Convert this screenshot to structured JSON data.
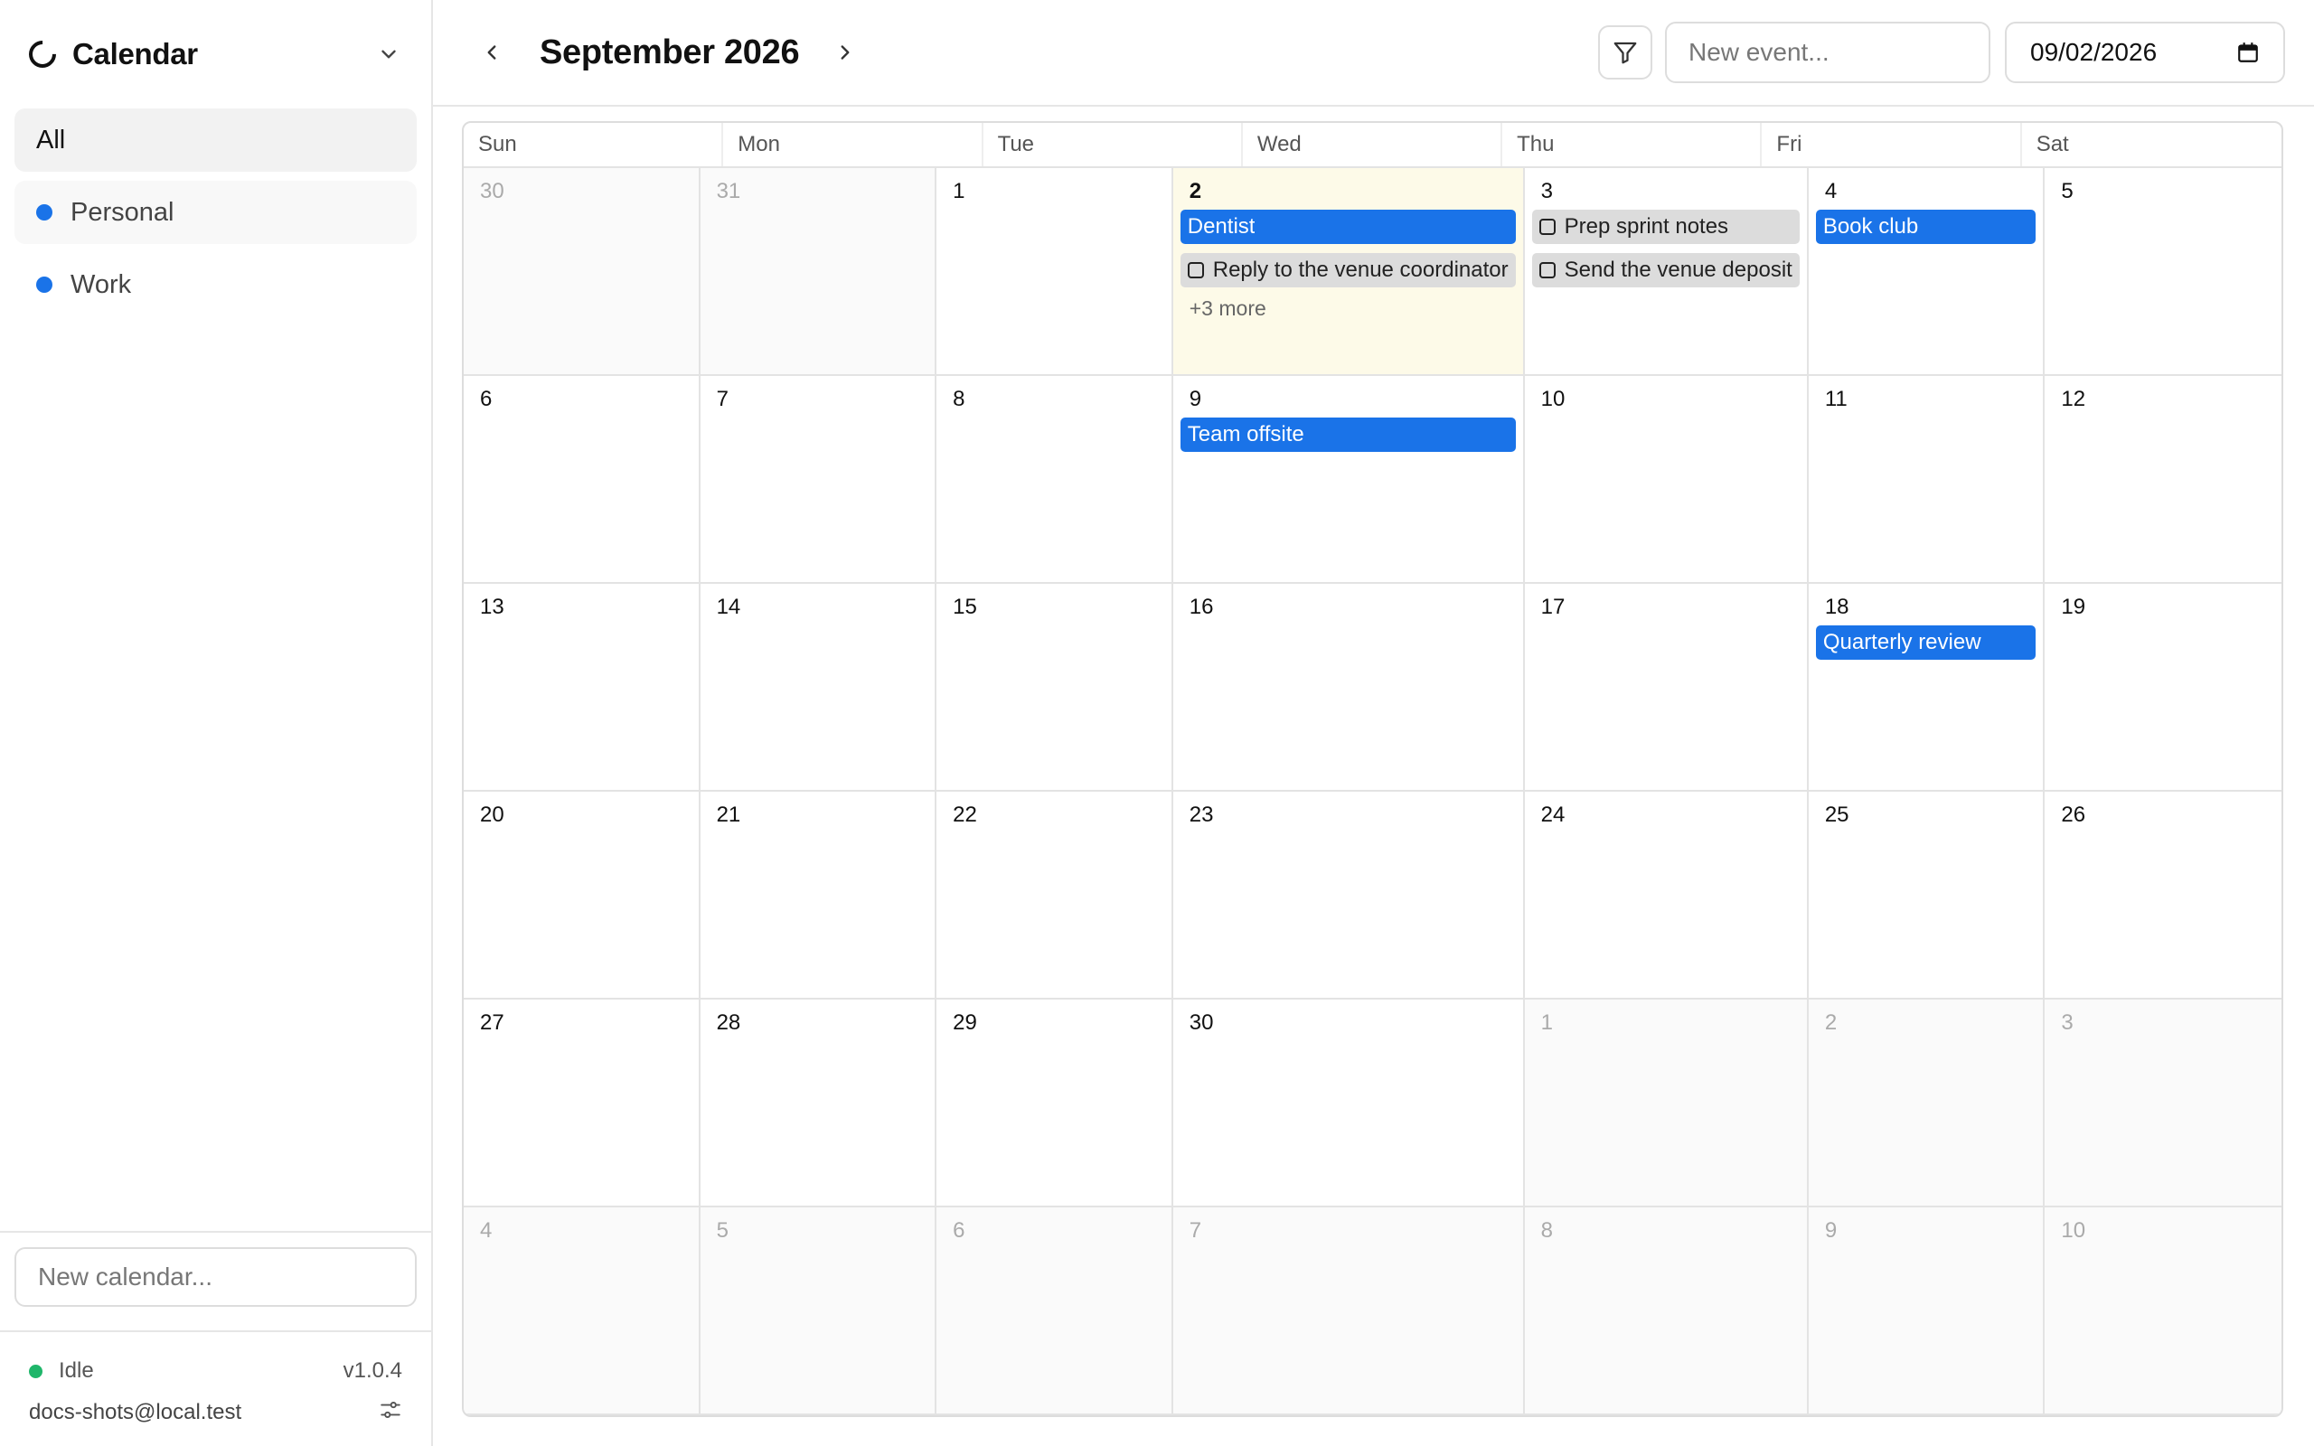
{
  "sidebar": {
    "title": "Calendar",
    "items": [
      {
        "label": "All"
      },
      {
        "label": "Personal",
        "color": "#1a73e8"
      },
      {
        "label": "Work",
        "color": "#1a73e8"
      }
    ],
    "new_calendar_placeholder": "New calendar...",
    "status": "Idle",
    "version": "v1.0.4",
    "email": "docs-shots@local.test"
  },
  "header": {
    "month": "September 2026",
    "new_event_placeholder": "New event...",
    "date_value": "09/02/2026"
  },
  "calendar": {
    "weekdays": [
      "Sun",
      "Mon",
      "Tue",
      "Wed",
      "Thu",
      "Fri",
      "Sat"
    ],
    "cells": [
      {
        "day": "30",
        "out": true
      },
      {
        "day": "31",
        "out": true
      },
      {
        "day": "1"
      },
      {
        "day": "2",
        "today": true,
        "events": [
          {
            "title": "Dentist",
            "type": "event"
          },
          {
            "title": "Reply to the venue coordinator",
            "type": "task"
          }
        ],
        "more": "+3 more"
      },
      {
        "day": "3",
        "events": [
          {
            "title": "Prep sprint notes",
            "type": "task"
          },
          {
            "title": "Send the venue deposit",
            "type": "task"
          }
        ]
      },
      {
        "day": "4",
        "events": [
          {
            "title": "Book club",
            "type": "event"
          }
        ]
      },
      {
        "day": "5"
      },
      {
        "day": "6"
      },
      {
        "day": "7"
      },
      {
        "day": "8"
      },
      {
        "day": "9",
        "events": [
          {
            "title": "Team offsite",
            "type": "event"
          }
        ]
      },
      {
        "day": "10"
      },
      {
        "day": "11"
      },
      {
        "day": "12"
      },
      {
        "day": "13"
      },
      {
        "day": "14"
      },
      {
        "day": "15"
      },
      {
        "day": "16"
      },
      {
        "day": "17"
      },
      {
        "day": "18",
        "events": [
          {
            "title": "Quarterly review",
            "type": "event"
          }
        ]
      },
      {
        "day": "19"
      },
      {
        "day": "20"
      },
      {
        "day": "21"
      },
      {
        "day": "22"
      },
      {
        "day": "23"
      },
      {
        "day": "24"
      },
      {
        "day": "25"
      },
      {
        "day": "26"
      },
      {
        "day": "27"
      },
      {
        "day": "28"
      },
      {
        "day": "29"
      },
      {
        "day": "30"
      },
      {
        "day": "1",
        "out": true
      },
      {
        "day": "2",
        "out": true
      },
      {
        "day": "3",
        "out": true
      },
      {
        "day": "4",
        "out": true
      },
      {
        "day": "5",
        "out": true
      },
      {
        "day": "6",
        "out": true
      },
      {
        "day": "7",
        "out": true
      },
      {
        "day": "8",
        "out": true
      },
      {
        "day": "9",
        "out": true
      },
      {
        "day": "10",
        "out": true
      }
    ]
  }
}
